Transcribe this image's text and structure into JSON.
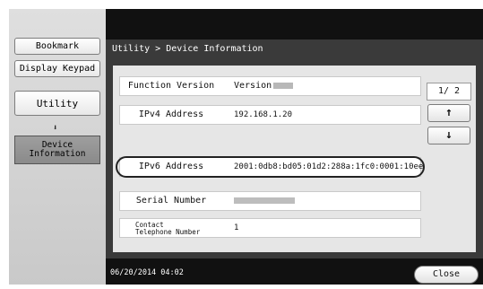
{
  "sidebar": {
    "bookmark_label": "Bookmark",
    "keypad_label": "Display Keypad",
    "utility_label": "Utility",
    "arrow": "⬇",
    "device_info_label": "Device\nInformation"
  },
  "panel": {
    "title": "Utility > Device Information"
  },
  "rows": [
    {
      "label": "Function Version",
      "value": "Version"
    },
    {
      "label": "IPv4 Address",
      "value": "192.168.1.20"
    },
    {
      "label": "IPv6 Address",
      "value": "2001:0db8:bd05:01d2:288a:1fc0:0001:10ee"
    },
    {
      "label": "Serial Number",
      "value": ""
    },
    {
      "label": "Contact\nTelephone Number",
      "value": "1"
    }
  ],
  "pager": {
    "text": "1/ 2",
    "up_glyph": "↑",
    "down_glyph": "↓"
  },
  "footer": {
    "datetime": "06/20/2014   04:02",
    "close_label": "Close"
  }
}
